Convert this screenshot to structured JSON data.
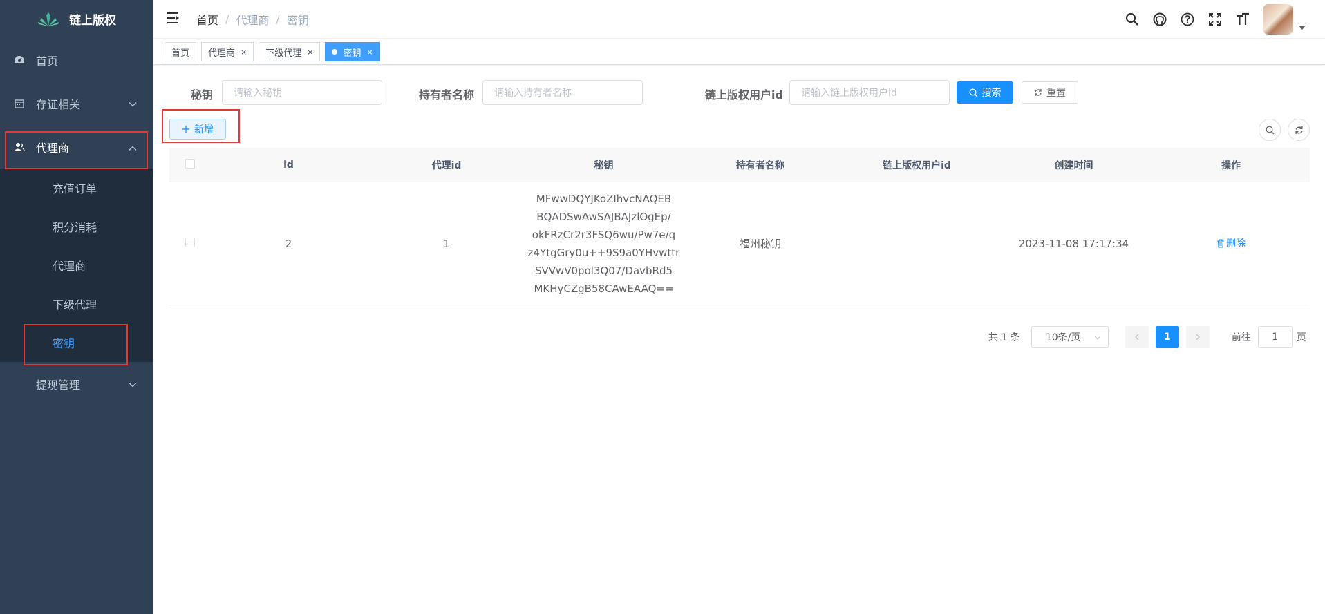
{
  "app": {
    "title": "链上版权"
  },
  "sidebar": {
    "items": [
      {
        "label": "首页"
      },
      {
        "label": "存证相关"
      },
      {
        "label": "代理商"
      },
      {
        "label": "提现管理"
      }
    ],
    "sub_items": [
      {
        "label": "充值订单"
      },
      {
        "label": "积分消耗"
      },
      {
        "label": "代理商"
      },
      {
        "label": "下级代理"
      },
      {
        "label": "密钥"
      }
    ]
  },
  "breadcrumb": {
    "first": "首页",
    "second": "代理商",
    "third": "密钥",
    "sep": "/"
  },
  "tags": [
    {
      "label": "首页"
    },
    {
      "label": "代理商"
    },
    {
      "label": "下级代理"
    },
    {
      "label": "密钥"
    }
  ],
  "search": {
    "key_label": "秘钥",
    "key_placeholder": "请输入秘钥",
    "holder_label": "持有者名称",
    "holder_placeholder": "请输入持有者名称",
    "user_label": "链上版权用户id",
    "user_placeholder": "请输入链上版权用户id",
    "search_btn": "搜索",
    "reset_btn": "重置"
  },
  "toolbar": {
    "add_btn": "新增"
  },
  "table": {
    "columns": [
      "id",
      "代理id",
      "秘钥",
      "持有者名称",
      "链上版权用户id",
      "创建时间",
      "操作"
    ],
    "rows": [
      {
        "id": "2",
        "agent_id": "1",
        "key_lines": [
          "MFwwDQYJKoZIhvcNAQEB",
          "BQADSwAwSAJBAJzlOgEp/",
          "okFRzCr2r3FSQ6wu/Pw7e/q",
          "z4YtgGry0u++9S9a0YHvwttr",
          "SVVwV0pol3Q07/DavbRd5",
          "MKHyCZgB58CAwEAAQ=="
        ],
        "holder": "福州秘钥",
        "user_id": "",
        "created": "2023-11-08 17:17:34",
        "action": "删除"
      }
    ]
  },
  "pagination": {
    "total": "共 1 条",
    "page_size": "10条/页",
    "current": "1",
    "goto_prefix": "前往",
    "goto_value": "1",
    "goto_suffix": "页"
  },
  "colors": {
    "sidebar_bg": "#304156",
    "submenu_bg": "#1f2d3d",
    "primary": "#1890ff",
    "highlight_box": "#e53935"
  }
}
